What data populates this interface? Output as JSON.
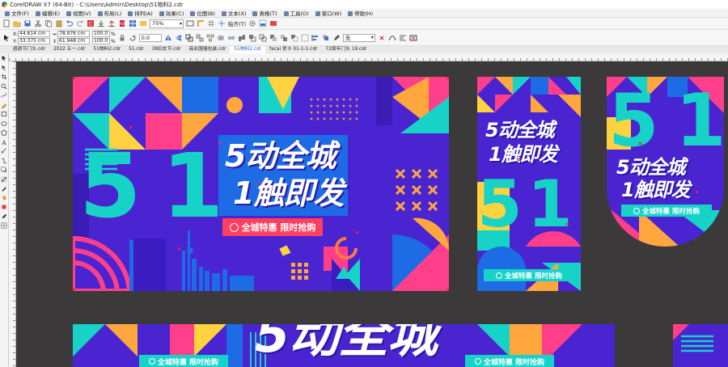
{
  "window": {
    "title": "CorelDRAW X7 (64-Bit) - C:\\Users\\Admin\\Desktop\\51物料2.cdr"
  },
  "menu": {
    "items": [
      "文件(F)",
      "编辑(E)",
      "视图(V)",
      "布局(L)",
      "排列(A)",
      "效果(C)",
      "位图(B)",
      "文本(X)",
      "表格(T)",
      "工具(O)",
      "窗口(W)",
      "帮助(H)"
    ]
  },
  "toolbar": {
    "zoom_value": "75%",
    "snap_label": "贴齐(T)"
  },
  "property_bar": {
    "x_label": "X:",
    "y_label": "Y:",
    "x_value": "44.614 cm",
    "y_value": "33.375 cm",
    "w_value": "78.976 cm",
    "h_value": "61.948 cm",
    "scale_w": "100.0",
    "scale_h": "100.0",
    "percent": "%",
    "angle_value": "0.0",
    "outline_value": "无"
  },
  "doc_tabs": [
    {
      "label": "感恩节门头.cdr",
      "active": false
    },
    {
      "label": "2022 五一.cdr",
      "active": false
    },
    {
      "label": "51物料2.cdr",
      "active": false
    },
    {
      "label": "51.cdr",
      "active": false
    },
    {
      "label": "38妇女节.cdr",
      "active": false
    },
    {
      "label": "商业围墙包装.cdr",
      "active": false
    },
    {
      "label": "51物料2.cdr",
      "active": true
    },
    {
      "label": "facai 贺卡 01-1-1.cdr",
      "active": false
    },
    {
      "label": "72周年门头 19.cdr",
      "active": false
    }
  ],
  "artwork": {
    "headline_line1": "5动全城",
    "headline_line2": "1触即发",
    "ribbon_text": "全城特惠 限时抢购",
    "big_five": "5",
    "big_one": "1"
  },
  "colors": {
    "canvas_bg": "#3b3939",
    "purple": "#5a1fd8",
    "blue": "#1e6be6",
    "teal": "#17d3c7",
    "pink": "#ff3f8a",
    "orange": "#ffa63f",
    "yellow": "#ffd23f",
    "ribbon_red": "#ff3f5f"
  }
}
